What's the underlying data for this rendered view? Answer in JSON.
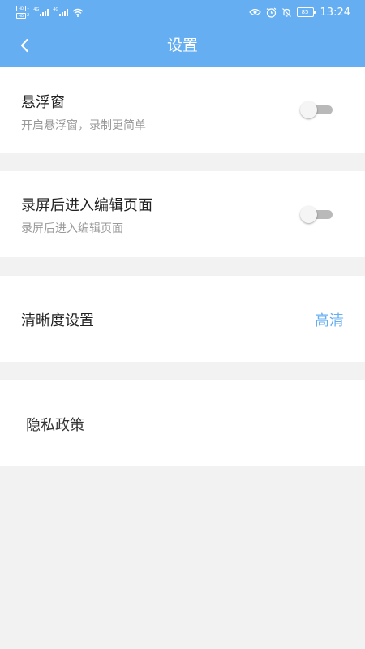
{
  "colors": {
    "header_bg": "#64aef1",
    "page_bg": "#f2f2f2",
    "accent": "#64aef1",
    "toggle_off": "#b9b9b9"
  },
  "status_bar": {
    "time": "13:24",
    "battery_level": "85",
    "left_icons": [
      "sim1-hd-icon",
      "sim2-hd-icon",
      "signal-4g-icon",
      "signal-4g-icon",
      "wifi-icon"
    ],
    "right_icons": [
      "eye-care-icon",
      "alarm-icon",
      "bell-muted-icon",
      "battery-icon"
    ]
  },
  "header": {
    "title": "设置",
    "back_icon": "chevron-left-icon"
  },
  "settings": {
    "floating_window": {
      "title": "悬浮窗",
      "subtitle": "开启悬浮窗，录制更简单",
      "enabled": false
    },
    "edit_after_record": {
      "title": "录屏后进入编辑页面",
      "subtitle": "录屏后进入编辑页面",
      "enabled": false
    },
    "clarity": {
      "title": "清晰度设置",
      "value": "高清"
    },
    "privacy": {
      "title": "隐私政策"
    }
  }
}
